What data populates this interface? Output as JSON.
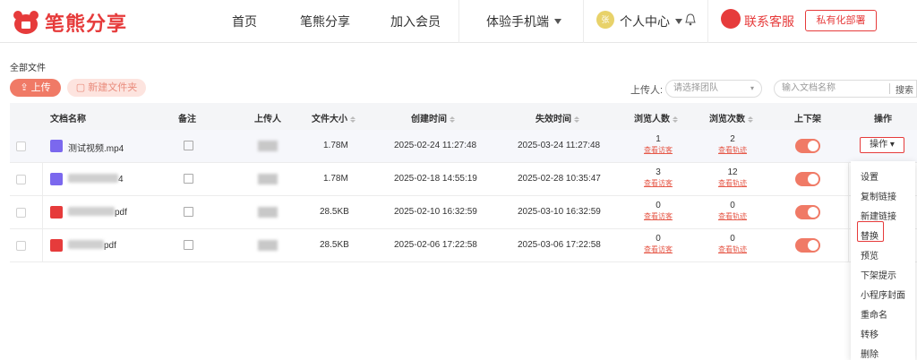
{
  "brand": {
    "name": "笔熊分享",
    "color": "#e63b3b"
  },
  "nav": {
    "home": "首页",
    "share": "笔熊分享",
    "join": "加入会员",
    "mobile": "体验手机端",
    "avatar_text": "张",
    "user_center": "个人中心",
    "customer_service": "联系客服",
    "private_deploy": "私有化部署"
  },
  "toolbar": {
    "breadcrumb": "全部文件",
    "upload": "上传",
    "new_folder": "新建文件夹",
    "uploader_label": "上传人:",
    "uploader_placeholder": "请选择团队",
    "search_placeholder": "输入文档名称",
    "search_button": "搜索"
  },
  "table": {
    "headers": {
      "name": "文档名称",
      "note": "备注",
      "uploader": "上传人",
      "size": "文件大小",
      "created": "创建时间",
      "expires": "失效时间",
      "viewers": "浏览人数",
      "views": "浏览次数",
      "listed": "上下架",
      "action": "操作"
    },
    "link_visitors": "查看访客",
    "link_trace": "查看轨迹",
    "action_button": "操作",
    "rows": [
      {
        "name": "测试视频.mp4",
        "type": "video",
        "size": "1.78M",
        "created": "2025-02-24 11:27:48",
        "expires": "2025-03-24 11:27:48",
        "viewers": "1",
        "views": "2",
        "listed": true
      },
      {
        "name": "4",
        "type": "video",
        "size": "1.78M",
        "created": "2025-02-18 14:55:19",
        "expires": "2025-02-28 10:35:47",
        "viewers": "3",
        "views": "12",
        "listed": true
      },
      {
        "name": "pdf",
        "type": "pdf",
        "size": "28.5KB",
        "created": "2025-02-10 16:32:59",
        "expires": "2025-03-10 16:32:59",
        "viewers": "0",
        "views": "0",
        "listed": true
      },
      {
        "name": "pdf",
        "type": "pdf",
        "size": "28.5KB",
        "created": "2025-02-06 17:22:58",
        "expires": "2025-03-06 17:22:58",
        "viewers": "0",
        "views": "0",
        "listed": true
      }
    ]
  },
  "menu": {
    "items": [
      "设置",
      "复制链接",
      "新建链接",
      "替换",
      "预览",
      "下架提示",
      "小程序封面",
      "重命名",
      "转移",
      "删除"
    ],
    "highlighted": "替换"
  }
}
